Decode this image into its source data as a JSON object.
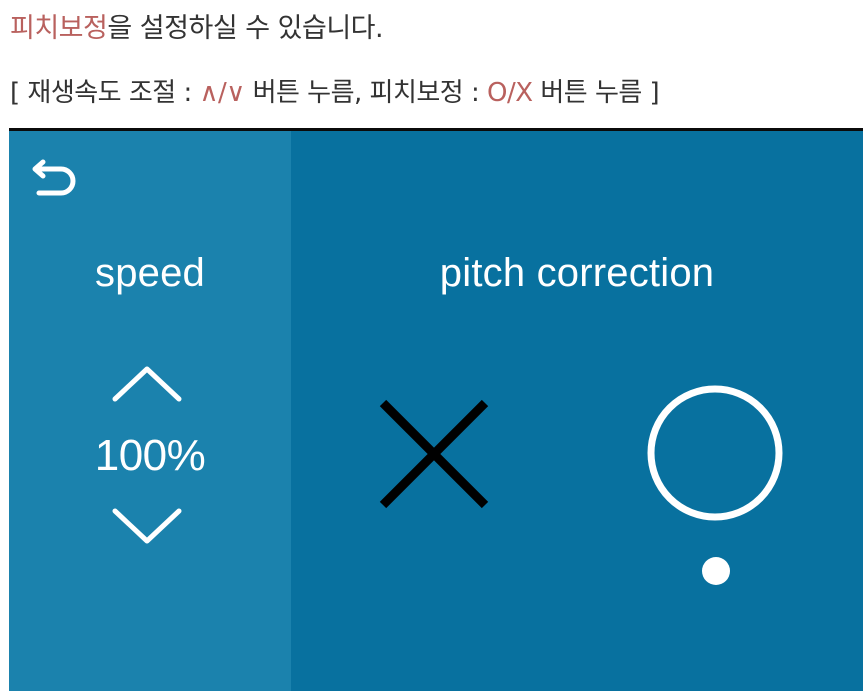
{
  "caption": {
    "line1_accent": "피치보정",
    "line1_rest": "을 설정하실 수 있습니다.",
    "line2_open": "[ 재생속도 조절 : ",
    "line2_up_down": "∧/∨",
    "line2_mid": " 버튼 누름, 피치보정 : ",
    "line2_o_x": "O/X",
    "line2_close": " 버튼 누름 ]"
  },
  "device": {
    "back_icon": "back-arrow-icon",
    "speed_title": "speed",
    "speed_value": "100%",
    "pitch_title": "pitch correction",
    "pitch_state_indicator": "O"
  },
  "colors": {
    "accent_text": "#b9615e",
    "panel_left": "#1b82ad",
    "panel_right": "#08719f",
    "x_mark": "#000000",
    "o_mark": "#ffffff"
  }
}
